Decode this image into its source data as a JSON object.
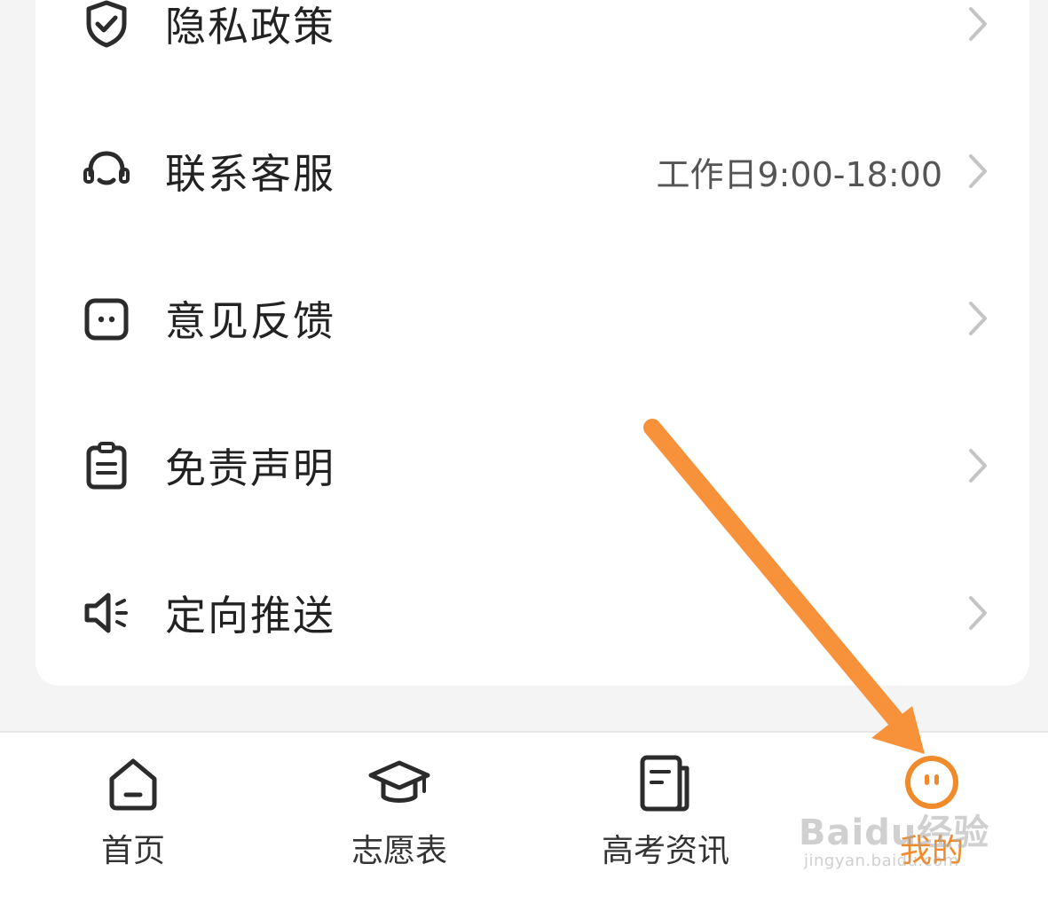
{
  "menu": {
    "items": [
      {
        "label": "隐私政策",
        "icon": "shield-check-icon"
      },
      {
        "label": "联系客服",
        "icon": "headset-icon",
        "extra": "工作日9:00-18:00"
      },
      {
        "label": "意见反馈",
        "icon": "chat-bubble-icon"
      },
      {
        "label": "免责声明",
        "icon": "clipboard-icon"
      },
      {
        "label": "定向推送",
        "icon": "speaker-icon"
      }
    ]
  },
  "tabbar": {
    "tabs": [
      {
        "label": "首页",
        "icon": "home-icon"
      },
      {
        "label": "志愿表",
        "icon": "graduation-cap-icon"
      },
      {
        "label": "高考资讯",
        "icon": "news-icon"
      },
      {
        "label": "我的",
        "icon": "profile-face-icon",
        "active": true
      }
    ]
  },
  "watermark": {
    "main": "Baidu经验",
    "sub": "jingyan.baidu.com"
  },
  "colors": {
    "accent": "#f08a2a",
    "arrow": "#f7923b"
  }
}
